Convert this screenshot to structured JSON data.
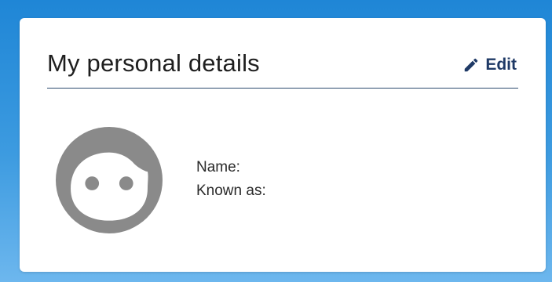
{
  "card": {
    "title": "My personal details",
    "edit_label": "Edit"
  },
  "details": {
    "name_label": "Name:",
    "name_value": "",
    "known_as_label": "Known as:",
    "known_as_value": ""
  },
  "icons": {
    "edit": "pencil-icon",
    "avatar": "face-avatar-icon"
  },
  "colors": {
    "background_top": "#1f86d6",
    "background_bottom": "#6db7ee",
    "card": "#ffffff",
    "link": "#1f3a66",
    "divider": "#2c4a6e",
    "avatar": "#8a8a8a"
  }
}
